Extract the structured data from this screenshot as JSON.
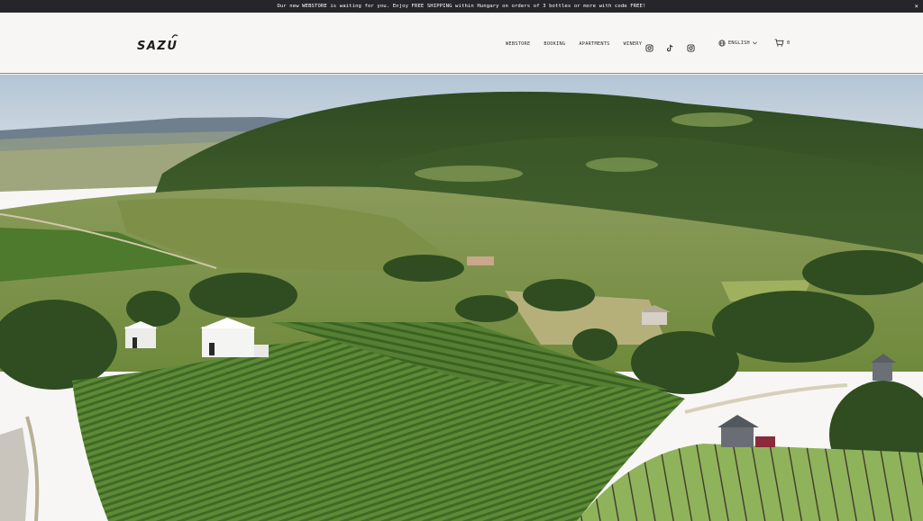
{
  "announcement": {
    "text": "Our new WEBSTORE is waiting for you. Enjoy FREE SHIPPING within Hungary on orders of 3 bottles or more with code FREE!",
    "close_label": "×"
  },
  "brand": {
    "name": "SAZU"
  },
  "nav": [
    {
      "label": "WEBSTORE"
    },
    {
      "label": "BOOKING"
    },
    {
      "label": "APARTMENTS"
    },
    {
      "label": "WINERY"
    }
  ],
  "social_icons": [
    "instagram-icon",
    "tiktok-icon",
    "instagram-icon"
  ],
  "language": {
    "label": "ENGLISH"
  },
  "cart": {
    "count": "0"
  },
  "colors": {
    "topbar": "#26262a",
    "header_bg": "#f8f6f4",
    "text": "#2a2a2a",
    "sky": "#b9c8d6",
    "forest": "#4a6a30",
    "vineyard": "#5f8a3a"
  }
}
